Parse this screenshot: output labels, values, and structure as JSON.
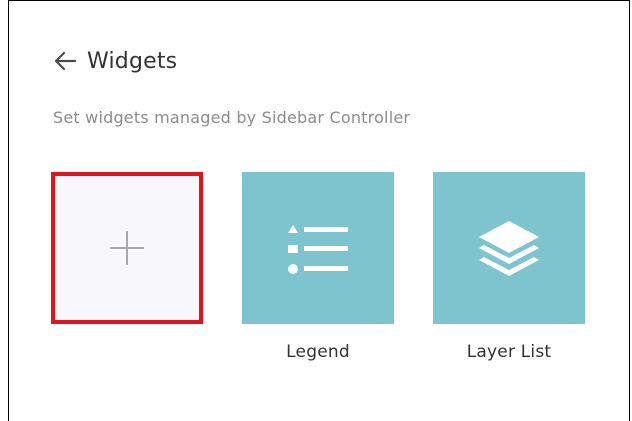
{
  "header": {
    "back_icon": "arrow-left-icon",
    "title": "Widgets"
  },
  "subtitle": "Set widgets managed by Sidebar Controller",
  "tiles": [
    {
      "kind": "add",
      "icon": "plus-icon",
      "label": ""
    },
    {
      "kind": "widget",
      "icon": "legend-icon",
      "label": "Legend"
    },
    {
      "kind": "widget",
      "icon": "layers-icon",
      "label": "Layer List"
    }
  ],
  "colors": {
    "tile_accent": "#7dc4cf",
    "add_tile_bg": "#f8f7fb",
    "highlight_border": "#e1141c",
    "subtitle_text": "#8c8c8c"
  }
}
